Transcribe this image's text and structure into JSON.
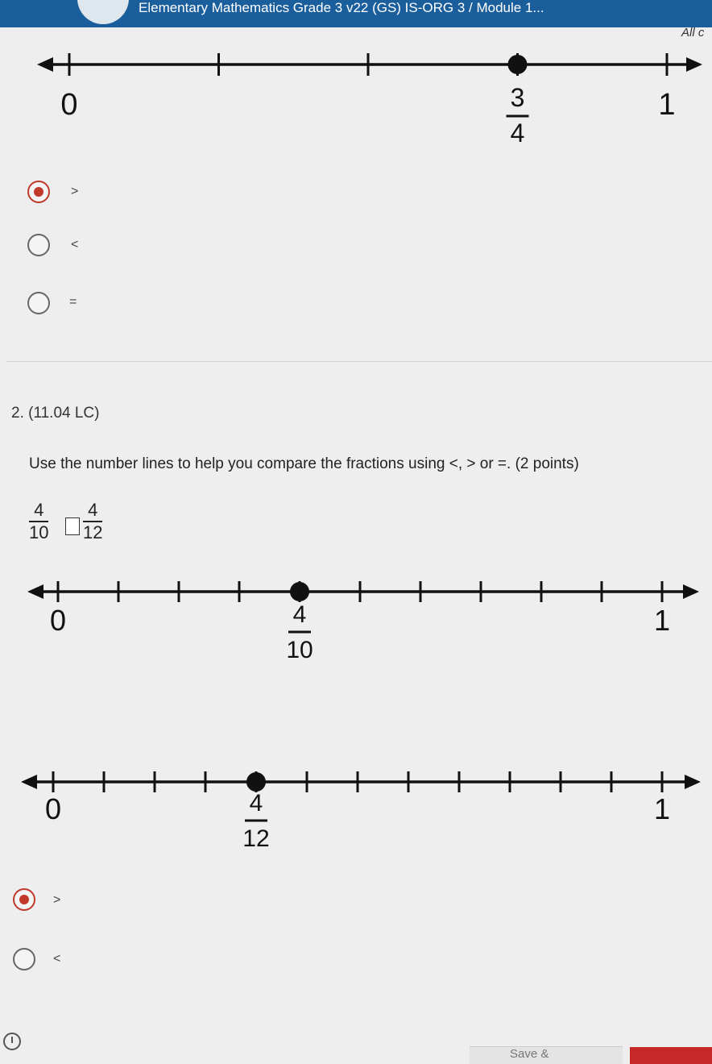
{
  "header": {
    "title": "Elementary Mathematics Grade 3 v22 (GS) IS-ORG 3 / Module 1..."
  },
  "all_link": "All c",
  "q1": {
    "number_line": {
      "start_label": "0",
      "end_label": "1",
      "point": {
        "num": "3",
        "den": "4",
        "value": 0.75
      },
      "divisions": 4
    },
    "options": [
      {
        "label": ">",
        "selected": true
      },
      {
        "label": "<",
        "selected": false
      },
      {
        "label": "=",
        "selected": false
      }
    ]
  },
  "q2": {
    "number": "2. (11.04 LC)",
    "prompt": "Use the number lines to help you compare the fractions using <, > or =. (2 points)",
    "left_fraction": {
      "num": "4",
      "den": "10"
    },
    "right_fraction": {
      "num": "4",
      "den": "12"
    },
    "number_line_a": {
      "start_label": "0",
      "end_label": "1",
      "point": {
        "num": "4",
        "den": "10",
        "value": 0.4
      },
      "divisions": 10
    },
    "number_line_b": {
      "start_label": "0",
      "end_label": "1",
      "point": {
        "num": "4",
        "den": "12",
        "value": 0.3333
      },
      "divisions": 12
    },
    "options": [
      {
        "label": ">",
        "selected": true
      },
      {
        "label": "<",
        "selected": false
      }
    ]
  },
  "footer": {
    "save_label": "Save &"
  },
  "colors": {
    "header_bg": "#1b5e9c",
    "radio_selected": "#c0392b",
    "submit": "#c62828"
  }
}
